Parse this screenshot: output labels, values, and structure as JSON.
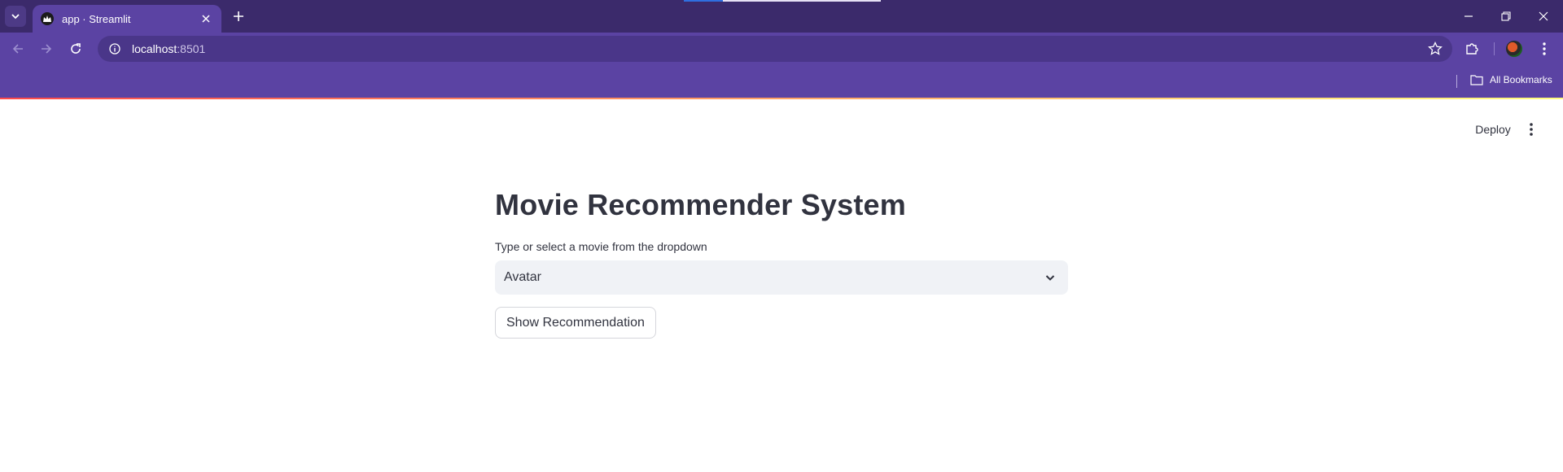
{
  "browser": {
    "tab": {
      "title": "app · Streamlit"
    },
    "address": {
      "host": "localhost",
      "port": ":8501"
    },
    "bookmarks": {
      "all_bookmarks_label": "All Bookmarks"
    },
    "colors": {
      "frame": "#3b2a6b",
      "toolbar": "#5b43a3",
      "omnibox": "#4a3689"
    }
  },
  "app": {
    "header": {
      "deploy_label": "Deploy"
    },
    "title": "Movie Recommender System",
    "select": {
      "label": "Type or select a movie from the dropdown",
      "value": "Avatar"
    },
    "button": {
      "label": "Show Recommendation"
    },
    "colors": {
      "text": "#31333f",
      "select_bg": "#f0f2f6",
      "decoration_start": "#ff4b4b",
      "decoration_end": "#fffd80"
    }
  }
}
